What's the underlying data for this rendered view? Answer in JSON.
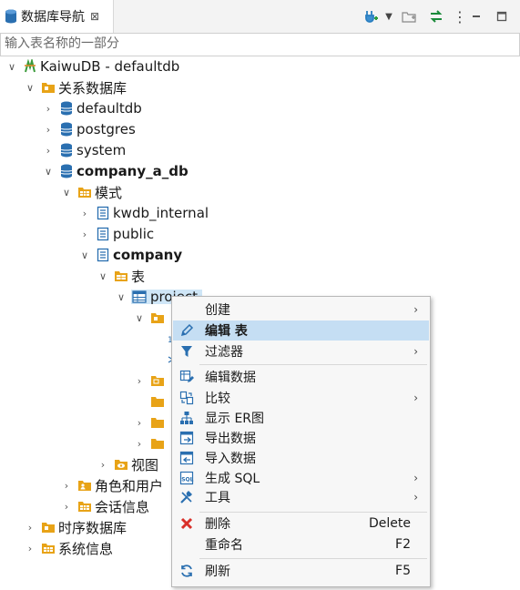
{
  "tab": {
    "title": "数据库导航",
    "close_glyph": "⊠"
  },
  "filter": {
    "placeholder": "输入表名称的一部分"
  },
  "tree": {
    "root": "KaiwuDB - defaultdb",
    "relational": "关系数据库",
    "defaultdb": "defaultdb",
    "postgres": "postgres",
    "system": "system",
    "company_a_db": "company_a_db",
    "schemas": "模式",
    "kwdb_internal": "kwdb_internal",
    "public": "public",
    "company": "company",
    "tables": "表",
    "project": "project",
    "views": "视图",
    "roles": "角色和用户",
    "sessions": "会话信息",
    "timeseries": "时序数据库",
    "sysinfo": "系统信息"
  },
  "menu": {
    "create": "创建",
    "edit_table": "编辑 表",
    "filter": "过滤器",
    "edit_data": "编辑数据",
    "compare": "比较",
    "show_er": "显示 ER图",
    "export": "导出数据",
    "import": "导入数据",
    "gen_sql": "生成 SQL",
    "tools": "工具",
    "delete": "删除",
    "delete_key": "Delete",
    "rename": "重命名",
    "rename_key": "F2",
    "refresh": "刷新",
    "refresh_key": "F5"
  },
  "colors": {
    "folder": "#e8a317",
    "db": "#2a6fb0",
    "selection": "#c5def3"
  }
}
